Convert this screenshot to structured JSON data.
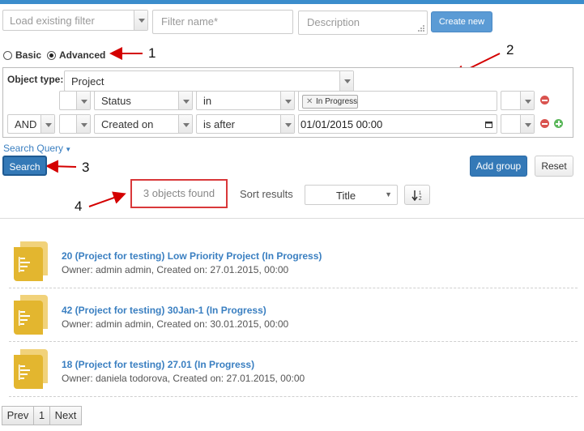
{
  "toolbar": {
    "filter_placeholder": "Load existing filter",
    "name_placeholder": "Filter name*",
    "description_placeholder": "Description",
    "create_label": "Create new"
  },
  "mode": {
    "basic_label": "Basic",
    "advanced_label": "Advanced",
    "selected": "Advanced"
  },
  "annotations": [
    "1",
    "2",
    "3",
    "4"
  ],
  "query": {
    "object_type_label": "Object type:",
    "object_type_value": "Project",
    "row1": {
      "field": "Status",
      "operator": "in",
      "value_tag": "In Progress"
    },
    "row2": {
      "conjunction": "AND",
      "field": "Created on",
      "operator": "is after",
      "value": "01/01/2015 00:00"
    }
  },
  "search_query_label": "Search Query",
  "search_label": "Search",
  "add_group_label": "Add group",
  "reset_label": "Reset",
  "results_count": "3 objects found",
  "sort_label": "Sort results",
  "sort_value": "Title",
  "results": [
    {
      "title": "20 (Project for testing) Low Priority Project (In Progress)",
      "meta": "Owner: admin admin, Created on: 27.01.2015, 00:00"
    },
    {
      "title": "42 (Project for testing) 30Jan-1 (In Progress)",
      "meta": "Owner: admin admin, Created on: 30.01.2015, 00:00"
    },
    {
      "title": "18 (Project for testing) 27.01 (In Progress)",
      "meta": "Owner: daniela todorova, Created on: 27.01.2015, 00:00"
    }
  ],
  "pagination": {
    "prev": "Prev",
    "page": "1",
    "next": "Next"
  },
  "colors": {
    "accent": "#3479b7",
    "annotation": "#d40000",
    "folder": "#e3b62f"
  }
}
